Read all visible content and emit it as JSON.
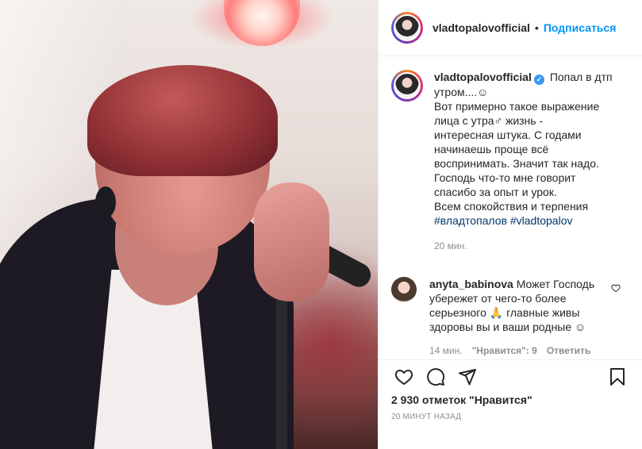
{
  "photo": {
    "alt": ""
  },
  "header": {
    "username": "vladtopalovofficial",
    "dot": "•",
    "follow_label": "Подписаться"
  },
  "caption": {
    "username": "vladtopalovofficial",
    "verified_glyph": "✓",
    "lines": [
      "Попал в дтп",
      "утром....☺",
      "Вот примерно такое выражение",
      "лица с утра♂ жизнь -",
      "интересная штука. С годами",
      "начинаешь проще всё",
      "воспринимать. Значит так надо.",
      "Господь что-то мне говорит",
      "спасибо за опыт и урок.",
      "Всем спокойствия и терпения"
    ],
    "hashtags": "#владтопалов #vladtopalov",
    "time": "20 мин."
  },
  "comment": {
    "username": "anyta_babinova",
    "text": "Может Господь убережет от чего-то более серьезного 🙏 главные живы здоровы вы и ваши родные ☺",
    "time": "14 мин.",
    "likes": "\"Нравится\": 9",
    "reply": "Ответить"
  },
  "actions": {
    "icons": [
      "heart-icon",
      "comment-icon",
      "share-icon",
      "bookmark-icon"
    ]
  },
  "likes_text": "2 930 отметок \"Нравится\"",
  "posted_ago": "20 МИНУТ НАЗАД"
}
